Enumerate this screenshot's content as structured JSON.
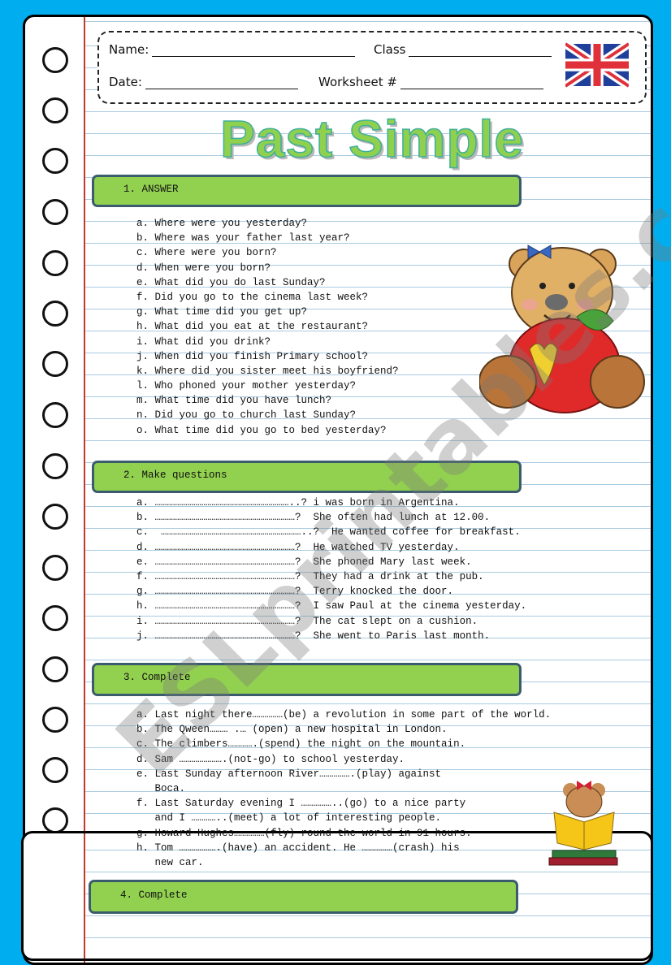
{
  "header": {
    "name_label": "Name:",
    "class_label": "Class",
    "date_label": "Date:",
    "worksheet_label": "Worksheet #",
    "flag_icon": "uk-flag-icon"
  },
  "title": "Past Simple",
  "colors": {
    "background": "#00aeef",
    "section_bar": "#92d050",
    "section_border": "#3b5c6e",
    "title_fill": "#8fd14f",
    "margin_line": "#c0392b",
    "ruled_line": "#a9cbe0"
  },
  "sections": [
    {
      "heading": "1. ANSWER",
      "items": [
        "a. Where were you yesterday?",
        "b. Where was your father last year?",
        "c. Where were you born?",
        "d. When were you born?",
        "e. What did you do last Sunday?",
        "f. Did you go to the cinema last week?",
        "g. What time did you get up?",
        "h. What did you eat at the restaurant?",
        "i. What did you drink?",
        "j. When did you finish Primary school?",
        "k. Where did you sister meet his boyfriend?",
        "l. Who phoned your mother yesterday?",
        "m. What time did you have lunch?",
        "n. Did you go to church last Sunday?",
        "o. What time did you go to bed yesterday?"
      ]
    },
    {
      "heading": "2. Make questions",
      "items": [
        "a. …………………………………………………………..? i was born in Argentina.",
        "b. ……………………………………………………………?  She often had lunch at 12.00.",
        "c.  ……………………………………………………………..?  He wanted coffee for breakfast.",
        "d. ……………………………………………………………?  He watched TV yesterday.",
        "e. ……………………………………………………………?  She phoned Mary last week.",
        "f. ……………………………………………………………?  They had a drink at the pub.",
        "g. ……………………………………………………………?  Terry knocked the door.",
        "h. ……………………………………………………………?  I saw Paul at the cinema yesterday.",
        "i. ……………………………………………………………?  The cat slept on a cushion.",
        "j. ……………………………………………………………?  She went to Paris last month."
      ]
    },
    {
      "heading": "3. Complete",
      "items": [
        "a. Last night there……………(be) a revolution in some part of the world.",
        "b. The Qween……… .… (open) a new hospital in London.",
        "c. The climbers………….(spend) the night on the mountain.",
        "d. Sam ………………….(not-go) to school yesterday.",
        "e. Last Sunday afternoon River…………….(play) against",
        "   Boca.",
        "f. Last Saturday evening I ……………..(go) to a nice party",
        "   and I …………..(meet) a lot of interesting people.",
        "g. Howard Hughes……………(fly) round the world in 91 hours.",
        "h. Tom ……………….(have) an accident. He ……………(crash) his",
        "   new car."
      ]
    },
    {
      "heading": "4. Complete",
      "items": []
    }
  ],
  "watermark": "ESLprintables.com",
  "images": {
    "bear_apple": "teddy-bear-with-apple",
    "bear_reading": "teddy-bear-reading-book"
  }
}
